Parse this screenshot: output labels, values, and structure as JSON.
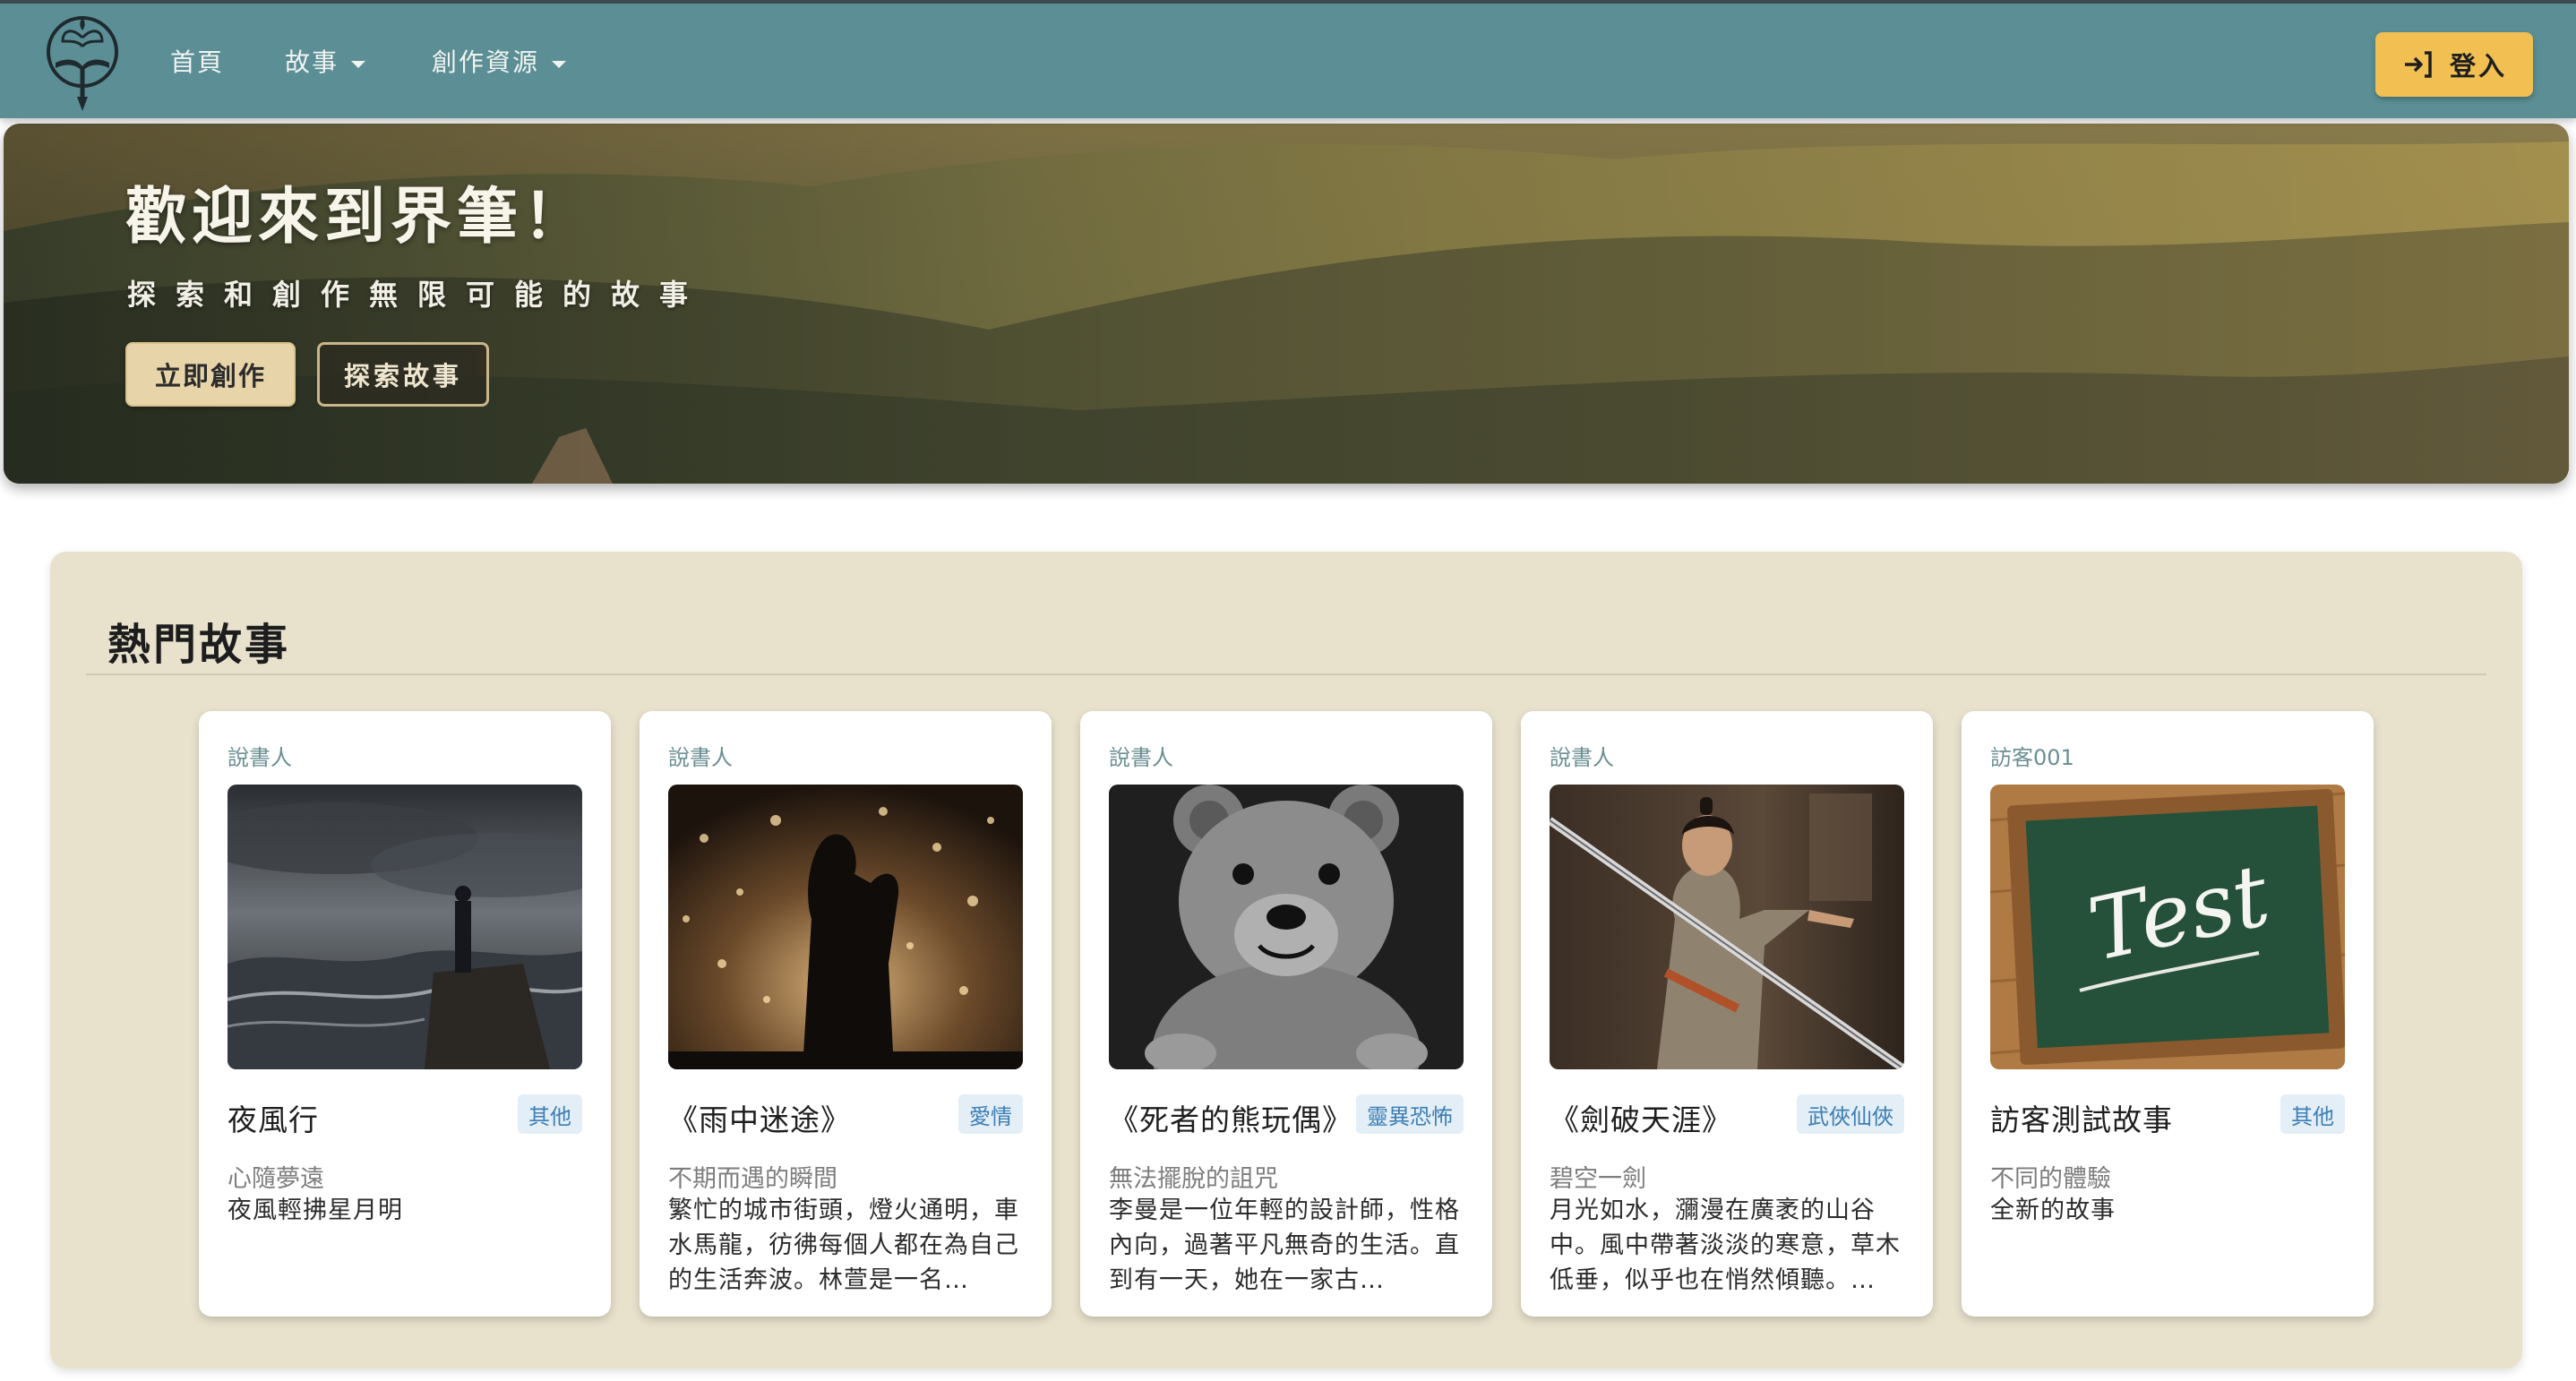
{
  "nav": {
    "home": "首頁",
    "stories": "故事",
    "resources": "創作資源",
    "login": "登入"
  },
  "hero": {
    "title": "歡迎來到界筆！",
    "subtitle": "探索和創作無限可能的故事",
    "create_button": "立即創作",
    "explore_button": "探索故事"
  },
  "popular": {
    "title": "熱門故事",
    "stories": [
      {
        "author": "說書人",
        "title": "夜風行",
        "tag": "其他",
        "subtitle": "心隨夢遠",
        "description": "夜風輕拂星月明"
      },
      {
        "author": "說書人",
        "title": "《雨中迷途》",
        "tag": "愛情",
        "subtitle": "不期而遇的瞬間",
        "description": "繁忙的城市街頭，燈火通明，車水馬龍，彷彿每個人都在為自己的生活奔波。林萱是一名…"
      },
      {
        "author": "說書人",
        "title": "《死者的熊玩偶》",
        "tag": "靈異恐怖",
        "subtitle": "無法擺脫的詛咒",
        "description": "李曼是一位年輕的設計師，性格內向，過著平凡無奇的生活。直到有一天，她在一家古…"
      },
      {
        "author": "說書人",
        "title": "《劍破天涯》",
        "tag": "武俠仙俠",
        "subtitle": "碧空一劍",
        "description": "月光如水，瀰漫在廣袤的山谷中。風中帶著淡淡的寒意，草木低垂，似乎也在悄然傾聽。…"
      },
      {
        "author": "訪客001",
        "title": "訪客測試故事",
        "tag": "其他",
        "subtitle": "不同的體驗",
        "description": "全新的故事",
        "image_text": "Test"
      }
    ]
  },
  "colors": {
    "navbar": "#5b8f95",
    "login_button": "#f1bf52",
    "section_bg": "#e8e2cd",
    "tag_bg": "#e3eef6",
    "tag_text": "#3d7fb5"
  },
  "icons": {
    "logo": "quill-pen-book-logo",
    "login": "sign-in-arrow-icon",
    "dropdown": "caret-down-icon"
  }
}
